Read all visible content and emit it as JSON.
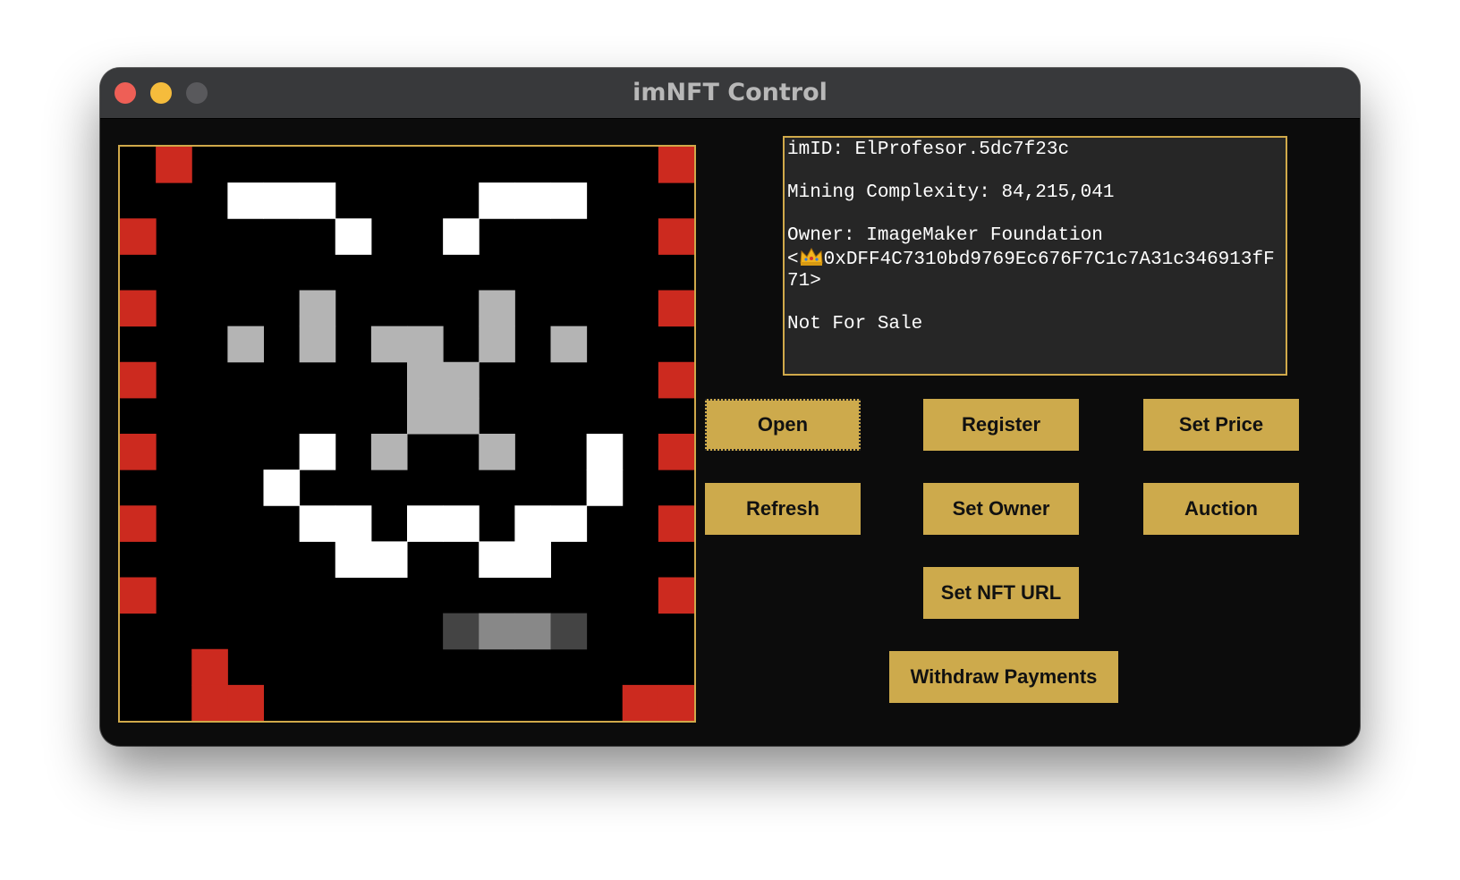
{
  "window": {
    "title": "imNFT Control",
    "accent_color": "#cdaa4c"
  },
  "info": {
    "imid": "imID: ElProfesor.5dc7f23c",
    "complexity": "Mining Complexity: 84,215,041",
    "owner_label": "Owner: ImageMaker Foundation",
    "owner_address_prefix": "<",
    "owner_icon": "crown-icon",
    "owner_address": "0xDFF4C7310bd9769Ec676F7C1c7A31c346913fF71>",
    "sale_status": "Not For Sale"
  },
  "buttons": {
    "open": "Open",
    "register": "Register",
    "set_price": "Set Price",
    "refresh": "Refresh",
    "set_owner": "Set Owner",
    "auction": "Auction",
    "set_nft_url": "Set NFT URL",
    "withdraw": "Withdraw Payments"
  },
  "image": {
    "colors": {
      "R": "#cc2a1f",
      "W": "#ffffff",
      "G": "#b4b4b4",
      "D": "#444444",
      "M": "#888888"
    },
    "rows": [
      ".R.............R",
      "...WWW....WWW...",
      "R.....W..W.....R",
      "................",
      "R....G....G....R",
      "...G.G.GG.G.G...",
      "R.......GG.....R",
      "........GG......",
      "R....W.G..G..W.R",
      "....W........W..",
      "R....WW.WW.WW..R",
      "......WW..WW....",
      "R..............R",
      ".........DMMD...",
      "..R.............",
      "..RR..........RR"
    ]
  }
}
